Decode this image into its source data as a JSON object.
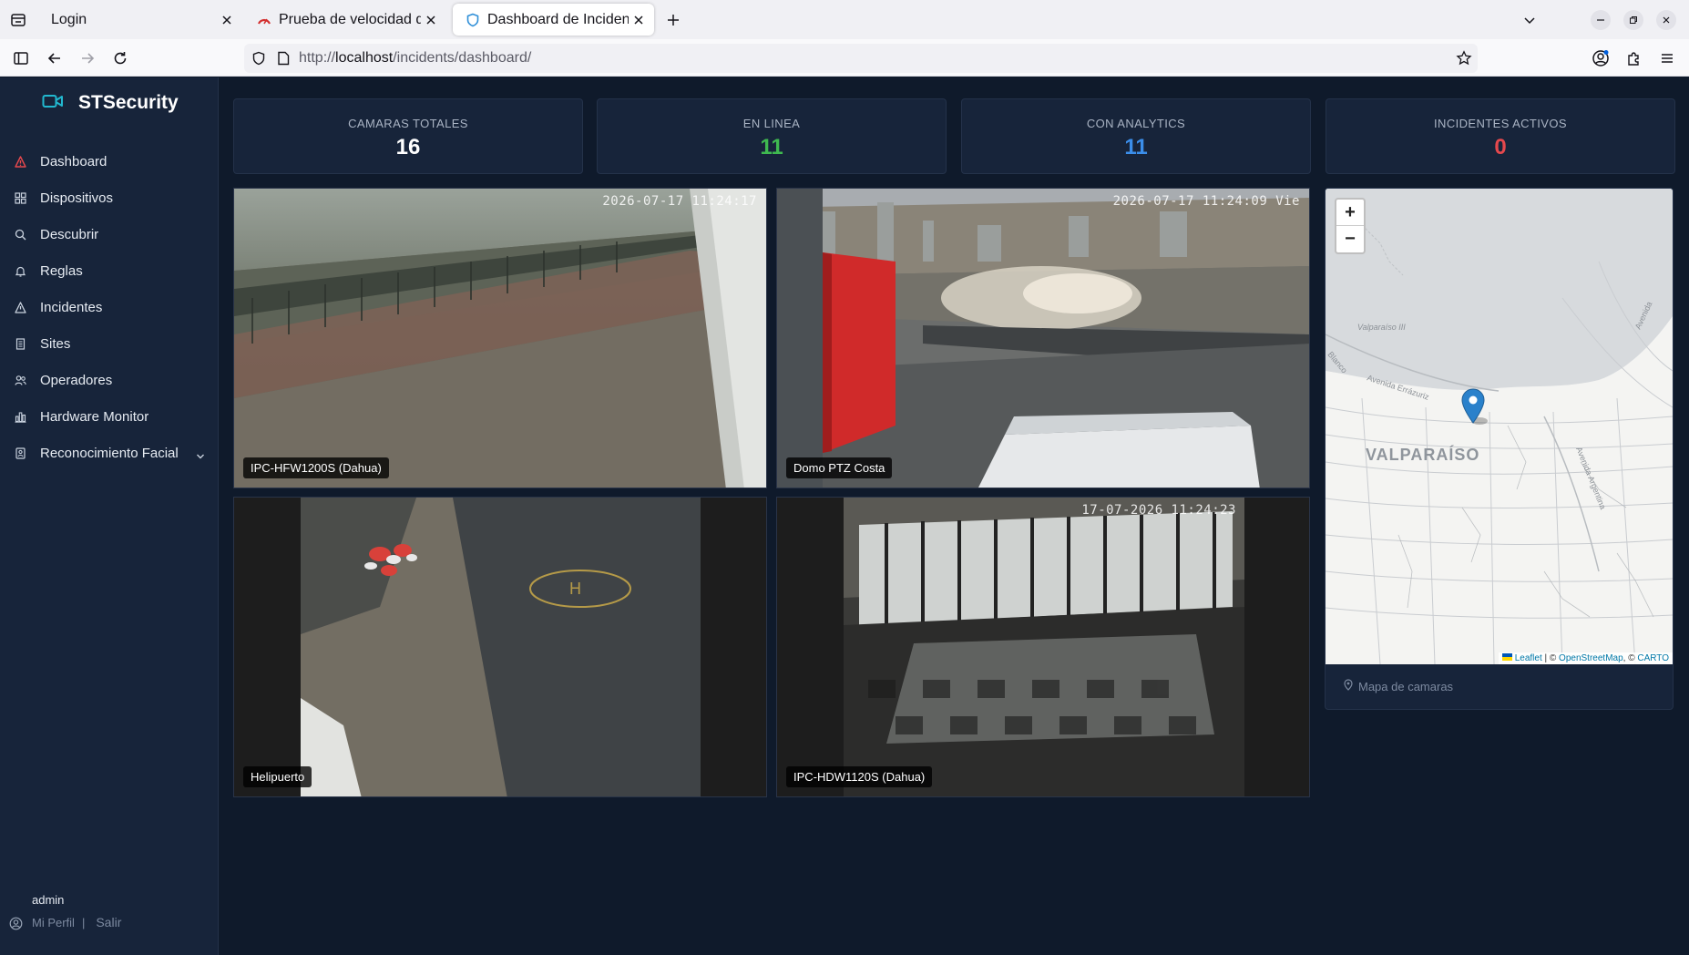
{
  "browser": {
    "tabs": [
      {
        "title": "Login",
        "active": false
      },
      {
        "title": "Prueba de velocidad de In",
        "active": false
      },
      {
        "title": "Dashboard de Incidentes",
        "active": true
      }
    ],
    "url_prefix": "http://",
    "url_host": "localhost",
    "url_path": "/incidents/dashboard/"
  },
  "app": {
    "brand": "STSecurity",
    "nav": [
      {
        "label": "Dashboard",
        "icon": "alert-triangle-icon"
      },
      {
        "label": "Dispositivos",
        "icon": "grid-icon"
      },
      {
        "label": "Descubrir",
        "icon": "search-icon"
      },
      {
        "label": "Reglas",
        "icon": "bell-icon"
      },
      {
        "label": "Incidentes",
        "icon": "warning-icon"
      },
      {
        "label": "Sites",
        "icon": "building-icon"
      },
      {
        "label": "Operadores",
        "icon": "users-icon"
      },
      {
        "label": "Hardware Monitor",
        "icon": "chart-icon"
      },
      {
        "label": "Reconocimiento Facial",
        "icon": "face-id-icon"
      }
    ],
    "user": {
      "name": "admin",
      "profile_link": "Mi Perfil",
      "logout_link": "Salir"
    }
  },
  "stats": [
    {
      "label": "CAMARAS TOTALES",
      "value": "16",
      "color": "#ffffff"
    },
    {
      "label": "EN LINEA",
      "value": "11",
      "color": "#3fb950"
    },
    {
      "label": "CON ANALYTICS",
      "value": "11",
      "color": "#3b8eea"
    },
    {
      "label": "INCIDENTES ACTIVOS",
      "value": "0",
      "color": "#e5484d"
    }
  ],
  "cameras": [
    {
      "name": "IPC-HFW1200S (Dahua)",
      "timestamp": "2026-07-17 11:24:17"
    },
    {
      "name": "Domo PTZ Costa",
      "timestamp": "2026-07-17 11:24:09 Vie"
    },
    {
      "name": "Helipuerto",
      "timestamp": ""
    },
    {
      "name": "IPC-HDW1120S (Dahua)",
      "timestamp": "17-07-2026 11:24:23"
    }
  ],
  "map": {
    "zoom_in": "+",
    "zoom_out": "−",
    "place_label": "VALPARAÍSO",
    "street_labels": [
      "Valparaíso III",
      "Avenida Errázuriz",
      "Avenida Argentina",
      "Avenida",
      "Blanco"
    ],
    "attribution": {
      "leaflet": "Leaflet",
      "sep1": " | © ",
      "osm": "OpenStreetMap",
      "sep2": ", © ",
      "carto": "CARTO"
    },
    "caption": "Mapa de camaras",
    "marker_color": "#2a81cb"
  }
}
